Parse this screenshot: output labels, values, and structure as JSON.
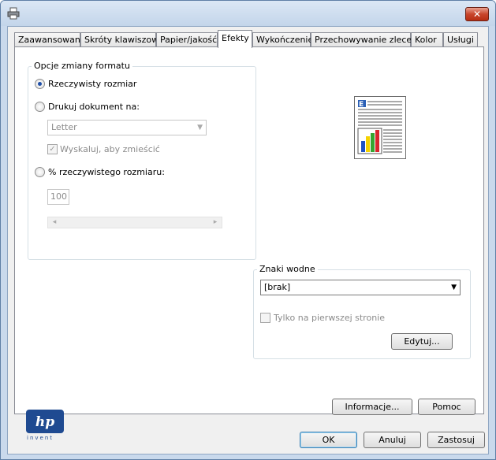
{
  "window": {
    "title": "",
    "close_glyph": "✕"
  },
  "tabs": [
    {
      "label": "Zaawansowane"
    },
    {
      "label": "Skróty klawiszowe"
    },
    {
      "label": "Papier/jakość"
    },
    {
      "label": "Efekty"
    },
    {
      "label": "Wykończenie"
    },
    {
      "label": "Przechowywanie zleceń"
    },
    {
      "label": "Kolor"
    },
    {
      "label": "Usługi"
    }
  ],
  "active_tab": "Efekty",
  "resize_group": {
    "legend": "Opcje zmiany formatu",
    "actual_size_label": "Rzeczywisty rozmiar",
    "actual_size_checked": true,
    "print_on_label": "Drukuj dokument na:",
    "print_on_checked": false,
    "paper_select_value": "Letter",
    "scale_to_fit_label": "Wyskaluj, aby zmieścić",
    "scale_to_fit_checked": true,
    "percent_label": "% rzeczywistego rozmiaru:",
    "percent_checked": false,
    "percent_value": "100",
    "scroll_left": "◂",
    "scroll_right": "▸"
  },
  "preview": {
    "letter": "E"
  },
  "watermark_group": {
    "legend": "Znaki wodne",
    "select_value": "[brak]",
    "first_page_only_label": "Tylko na pierwszej stronie",
    "first_page_only_checked": false,
    "edit_button": "Edytuj..."
  },
  "brand": {
    "logo_text": "hp",
    "tagline": "invent",
    "color": "#1f4a91"
  },
  "buttons": {
    "info": "Informacje...",
    "help": "Pomoc",
    "ok": "OK",
    "cancel": "Anuluj",
    "apply": "Zastosuj"
  },
  "colors": {
    "chart_bar_1": "#1f52c4",
    "chart_bar_2": "#f5d200",
    "chart_bar_3": "#35a531",
    "chart_bar_4": "#d8262e"
  }
}
